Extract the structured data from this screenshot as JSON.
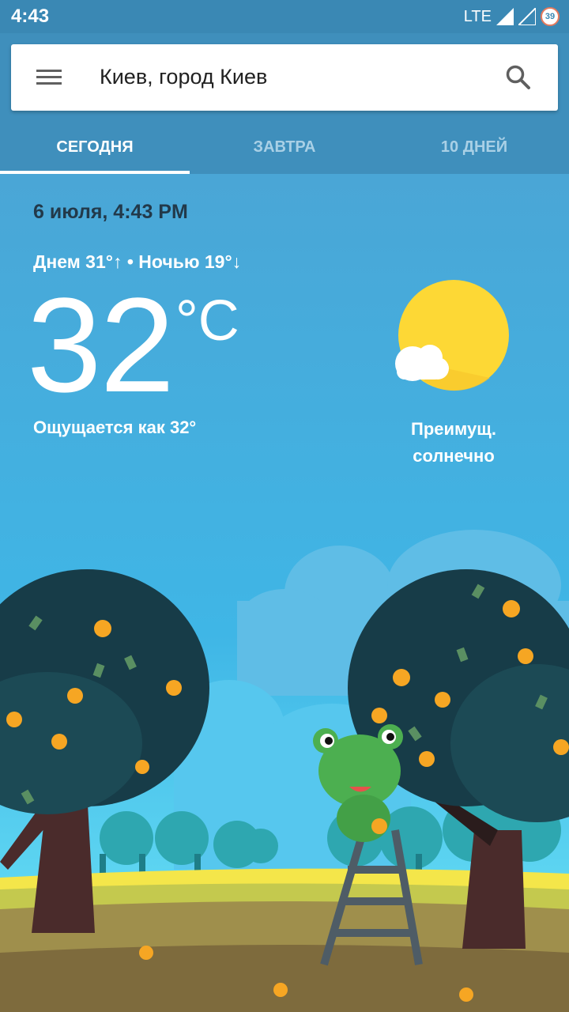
{
  "status_bar": {
    "time": "4:43",
    "network": "LTE",
    "battery": "39"
  },
  "search": {
    "location": "Киев, город Киев"
  },
  "tabs": [
    {
      "label": "СЕГОДНЯ",
      "active": true
    },
    {
      "label": "ЗАВТРА",
      "active": false
    },
    {
      "label": "10 ДНЕЙ",
      "active": false
    }
  ],
  "weather": {
    "datetime": "6 июля, 4:43 PM",
    "hi_lo": "Днем 31°↑ • Ночью 19°↓",
    "temperature": "32",
    "unit": "°C",
    "feels_like": "Ощущается как 32°",
    "condition_line1": "Преимущ.",
    "condition_line2": "солнечно",
    "icon": "sun-with-cloud-icon"
  },
  "colors": {
    "status_bar": "#3a88b4",
    "header": "#3f8fbc",
    "sky": "#4aa6d6",
    "sun": "#fdd835"
  }
}
